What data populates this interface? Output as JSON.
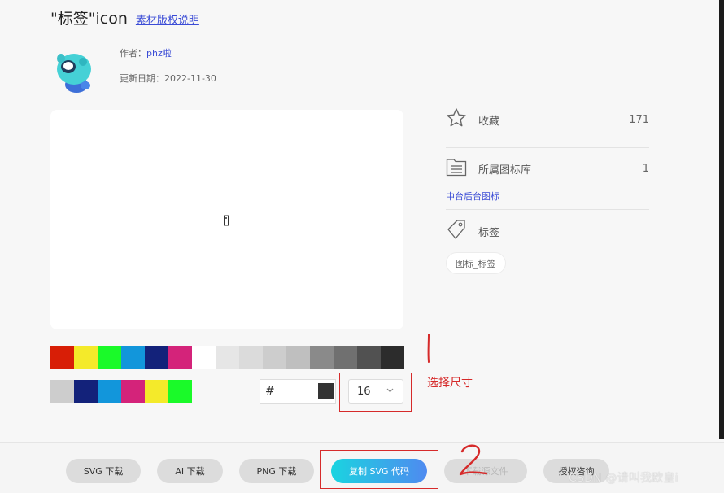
{
  "header": {
    "title": "\"标签\"icon",
    "copyright_link": "素材版权说明"
  },
  "meta": {
    "author_label": "作者：",
    "author_name": "phz啦",
    "date_label": "更新日期：",
    "date_value": "2022-11-30"
  },
  "sidebar": {
    "favorite_label": "收藏",
    "favorite_count": "171",
    "library_label": "所属图标库",
    "library_count": "1",
    "library_link": "中台后台图标",
    "tags_label": "标签",
    "tag_chip": "图标_标签"
  },
  "palette": {
    "row1": [
      "#d81e06",
      "#f4ea2a",
      "#1afa29",
      "#1296db",
      "#13227a",
      "#d4237a",
      "#ffffff",
      "#e6e6e6",
      "#dbdbdb",
      "#cdcdcd",
      "#bfbfbf",
      "#8a8a8a",
      "#707070",
      "#515151",
      "#2c2c2c"
    ],
    "row2": [
      "#cdcdcd",
      "#13227a",
      "#1296db",
      "#d4237a",
      "#f4ea2a",
      "#1afa29"
    ]
  },
  "color_input": {
    "hash": "#",
    "value": "",
    "current_color": "#333333"
  },
  "size_select": {
    "value": "16"
  },
  "annotations": {
    "text": "选择尺寸",
    "marker_1": "1",
    "marker_2": "2",
    "color": "#d62a2a"
  },
  "footer": {
    "svg_download": "SVG 下载",
    "ai_download": "AI 下载",
    "png_download": "PNG 下载",
    "copy_svg": "复制 SVG 代码",
    "source_download": "下载源文件",
    "license": "授权咨询"
  },
  "watermark": "CSDN @请叫我欧皇i"
}
